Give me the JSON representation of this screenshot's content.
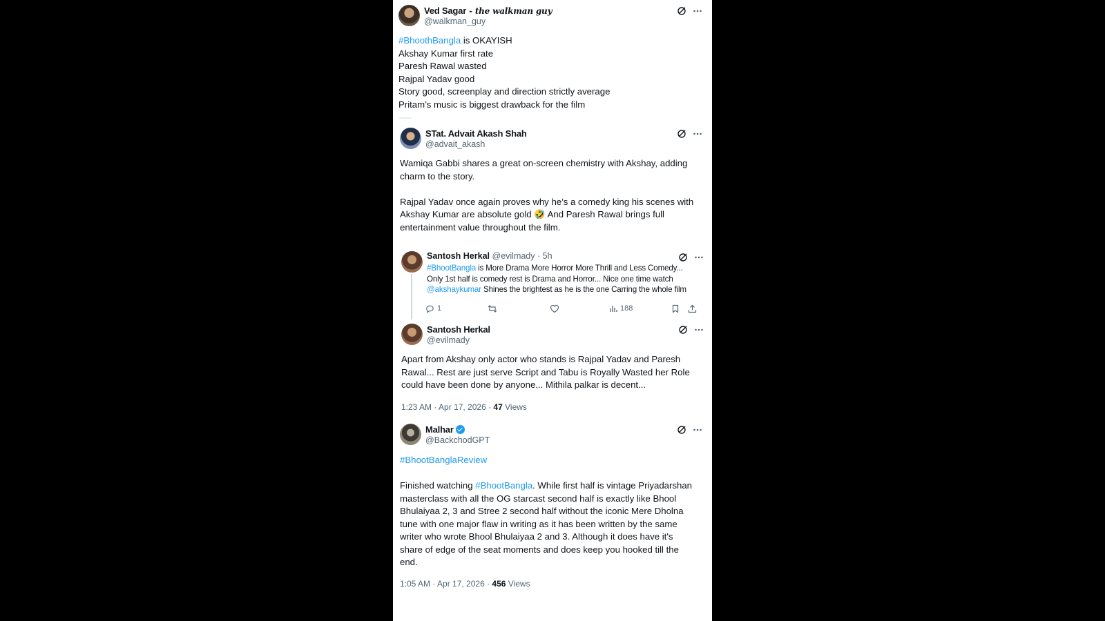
{
  "tweets": [
    {
      "name": "Ved Sagar",
      "name_suffix": " - the walkman guy",
      "handle": "@walkman_guy",
      "hashtag": "#BhoothBangla",
      "first_line_rest": " is OKAYISH",
      "lines": [
        "Akshay Kumar first rate",
        "Paresh Rawal wasted",
        "Rajpal Yadav good",
        "Story good, screenplay and direction strictly average",
        "Pritam’s music is biggest drawback for the film"
      ]
    },
    {
      "name": "STat. Advait Akash Shah",
      "handle": "@advait_akash",
      "lines": [
        "Wamiqa Gabbi shares a great on-screen chemistry with Akshay, adding",
        "charm to the story.",
        "",
        "Rajpal Yadav once again proves why he’s a comedy king  his scenes with",
        "Akshay Kumar are absolute gold 🤣 And Paresh Rawal brings full",
        "entertainment value throughout the film."
      ]
    },
    {
      "name": "Santosh Herkal",
      "handle": "@evilmady",
      "time": "· 5h",
      "line1_tag": "#BhootBangla",
      "line1_rest": " is More Drama More Horror More Thrill and Less Comedy...",
      "line2": "Only 1st half is comedy rest is Drama and Horror... Nice one time watch",
      "line3_tag": "@akshaykumar",
      "line3_rest": " Shines the brightest as he is the one Carring the whole film",
      "replies": "1",
      "views": "188"
    },
    {
      "name": "Santosh Herkal",
      "handle": "@evilmady",
      "lines": [
        "Apart from Akshay only actor who stands is Rajpal Yadav and Paresh",
        "Rawal... Rest are just serve Script and Tabu is Royally Wasted her Role",
        "could have been done by anyone... Mithila palkar is decent..."
      ],
      "timestamp": "1:23 AM · Apr 17, 2026 · ",
      "views_count": "47",
      "views_label": " Views"
    },
    {
      "name": "Malhar",
      "handle": "@BackchodGPT",
      "hashtag_line": "#BhootBanglaReview",
      "line1_pre": "Finished watching ",
      "line1_tag": "#BhootBangla",
      "line1_rest": ". While first half is vintage Priyadarshan",
      "lines": [
        "masterclass with all the OG starcast second half is exactly like Bhool",
        "Bhulaiyaa 2, 3 and Stree 2 second half without the iconic Mere Dholna",
        "tune with one major flaw in writing as it has been written by the same",
        "writer who wrote Bhool Bhulaiyaa 2 and 3. Although it does have it's",
        "share of edge of the seat moments and does keep you hooked till the",
        "end."
      ],
      "timestamp": "1:05 AM · Apr 17, 2026 · ",
      "views_count": "456",
      "views_label": " Views"
    }
  ],
  "colors": {
    "link": "#1d9bf0",
    "muted": "#536471",
    "text": "#0f1419"
  }
}
